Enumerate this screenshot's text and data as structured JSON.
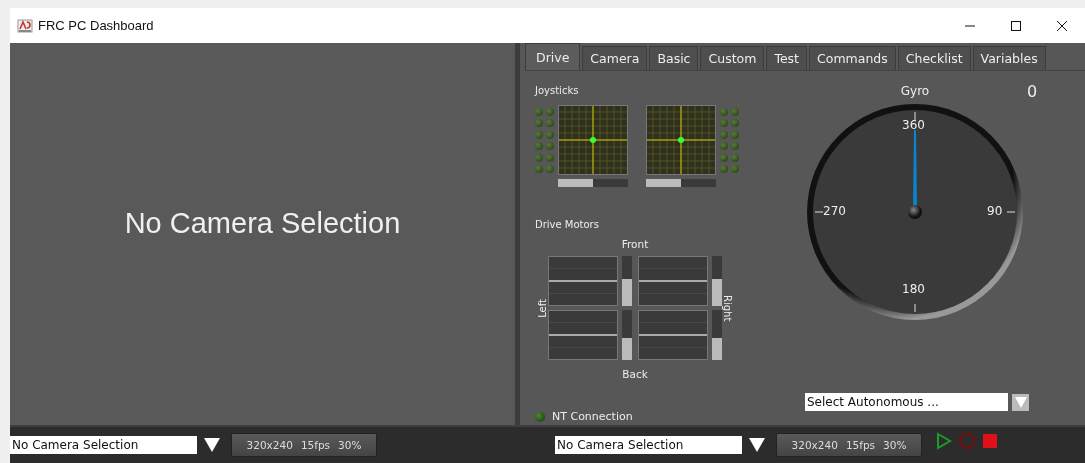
{
  "window": {
    "title": "FRC PC Dashboard"
  },
  "camera_panel": {
    "message": "No Camera Selection"
  },
  "tabs": [
    {
      "label": "Drive",
      "selected": true
    },
    {
      "label": "Camera",
      "selected": false
    },
    {
      "label": "Basic",
      "selected": false
    },
    {
      "label": "Custom",
      "selected": false
    },
    {
      "label": "Test",
      "selected": false
    },
    {
      "label": "Commands",
      "selected": false
    },
    {
      "label": "Checklist",
      "selected": false
    },
    {
      "label": "Variables",
      "selected": false
    }
  ],
  "joysticks": {
    "title": "Joysticks",
    "items": [
      {
        "level": 0.5,
        "buttons": [
          false,
          false,
          false,
          false,
          false,
          false,
          false,
          false,
          false,
          false,
          false,
          false
        ]
      },
      {
        "level": 0.5,
        "buttons": [
          false,
          false,
          false,
          false,
          false,
          false,
          false,
          false,
          false,
          false,
          false,
          false
        ]
      }
    ]
  },
  "drive_motors": {
    "title": "Drive Motors",
    "front": "Front",
    "back": "Back",
    "left": "Left",
    "right": "Right",
    "motors": [
      {
        "level": 0.55
      },
      {
        "level": 0.55
      },
      {
        "level": 0.45
      },
      {
        "level": 0.45
      }
    ]
  },
  "nt_connection": {
    "label": "NT Connection",
    "on": false
  },
  "gyro": {
    "title": "Gyro",
    "value": "0",
    "dial_labels": [
      "360",
      "90",
      "180",
      "270"
    ]
  },
  "autonomous": {
    "value": "Select Autonomous ..."
  },
  "bottom_bars": [
    {
      "camera": "No Camera Selection",
      "settings": [
        "320x240",
        "15fps",
        "30%"
      ]
    },
    {
      "camera": "No Camera Selection",
      "settings": [
        "320x240",
        "15fps",
        "30%"
      ],
      "controls": [
        {
          "kind": "play"
        },
        {
          "kind": "record"
        },
        {
          "kind": "stop"
        }
      ]
    }
  ]
}
